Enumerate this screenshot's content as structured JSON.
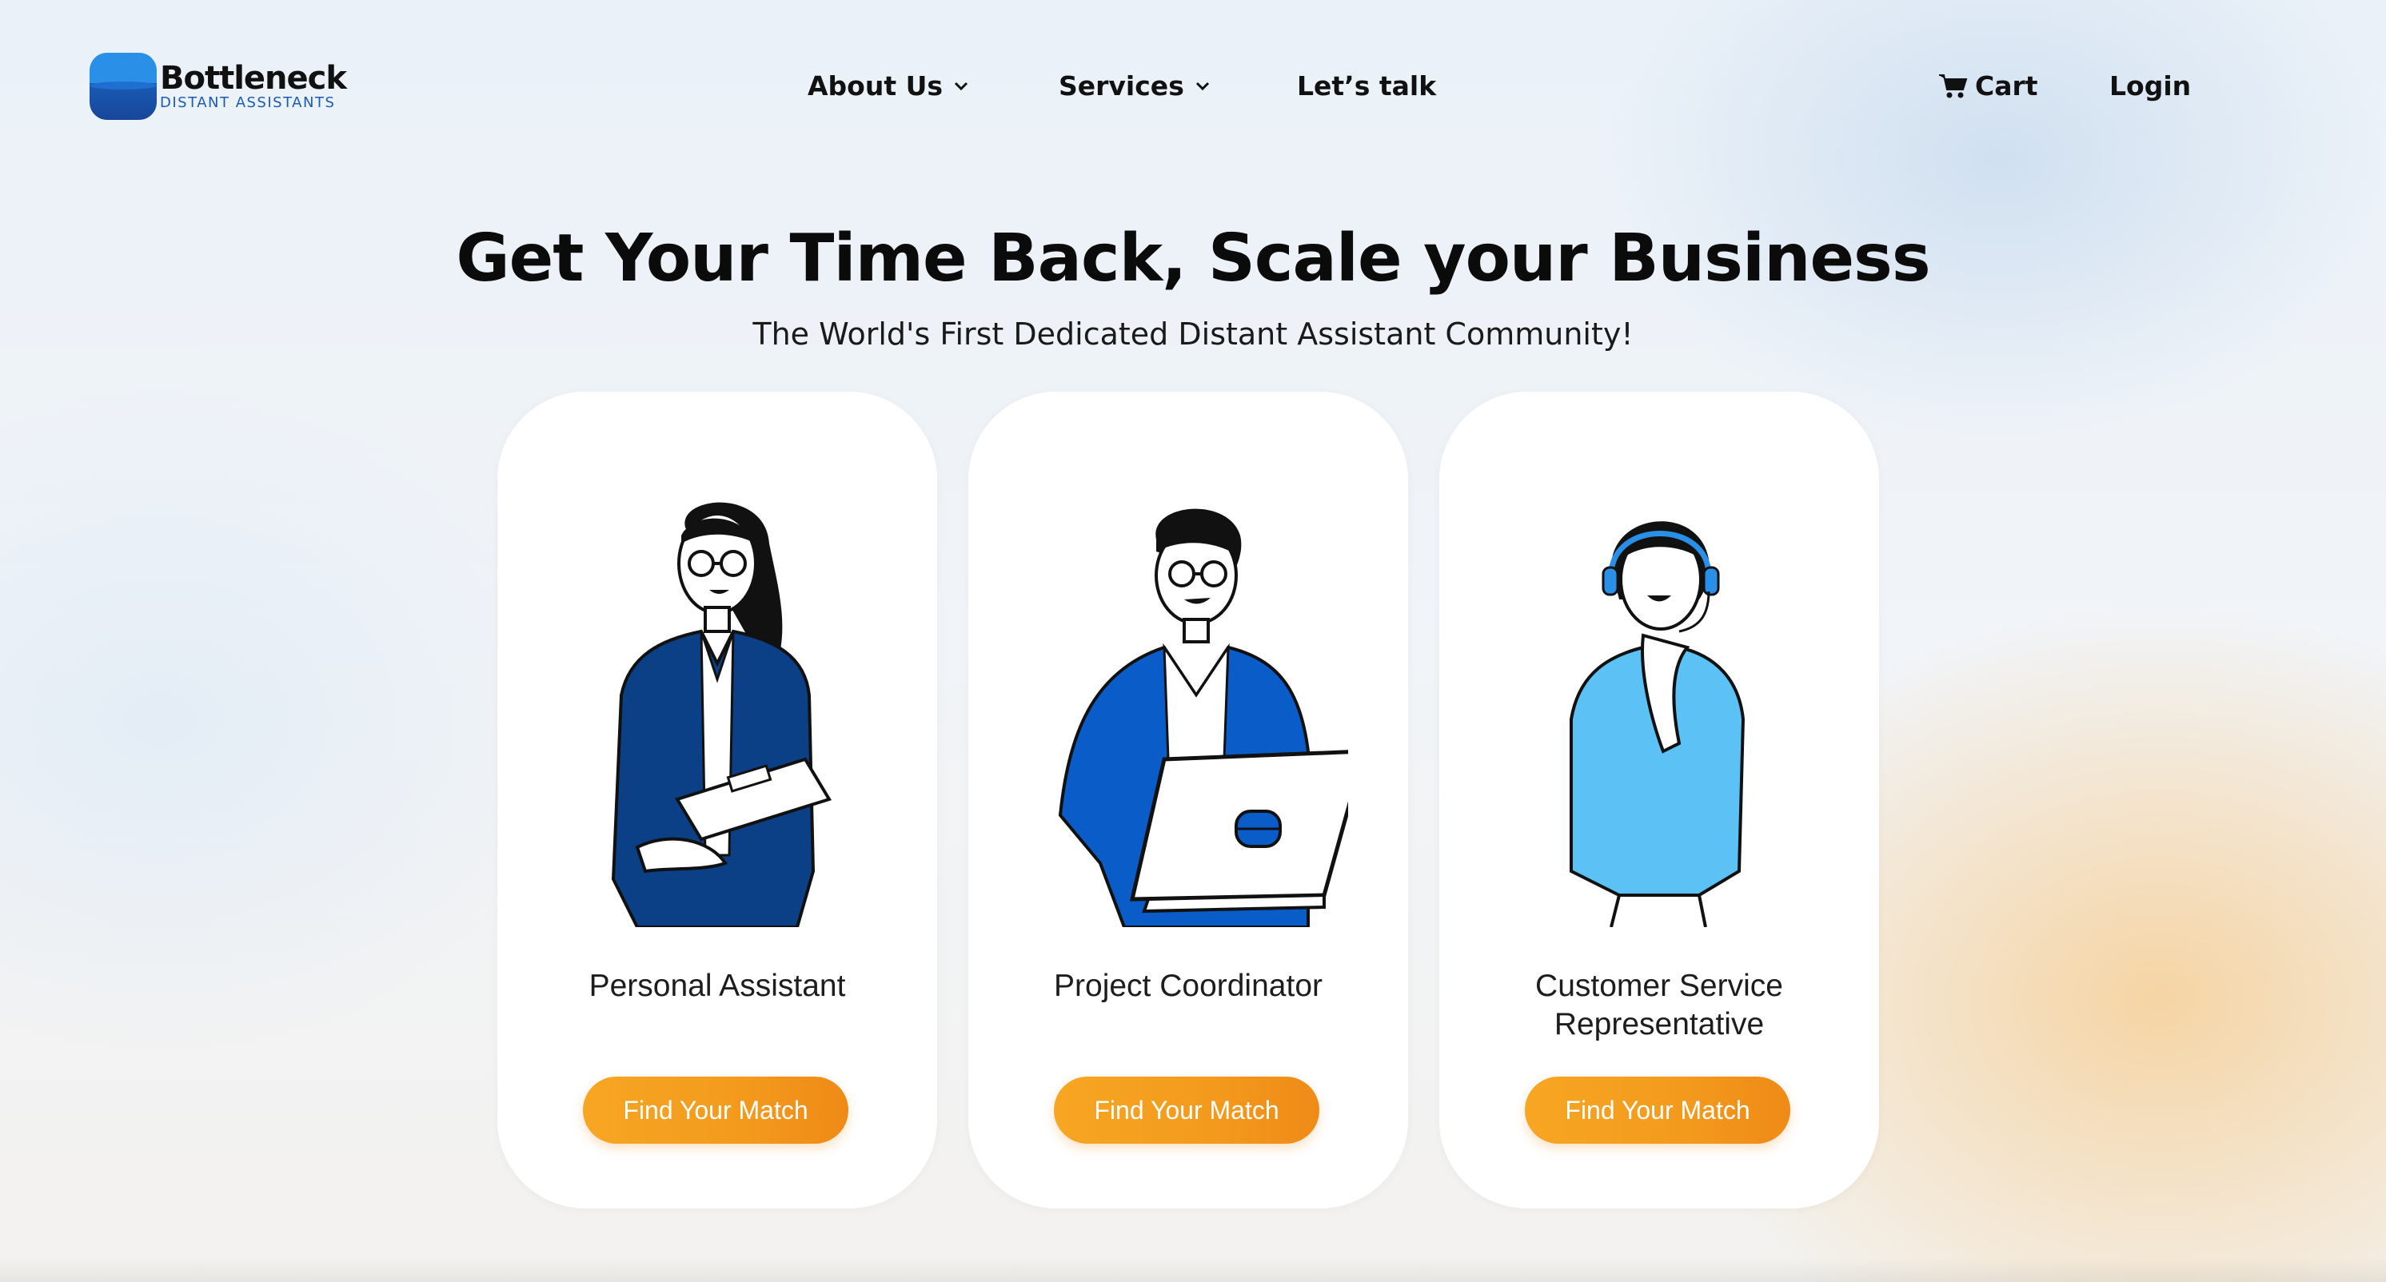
{
  "brand": {
    "name": "Bottleneck",
    "tagline": "DISTANT ASSISTANTS"
  },
  "nav": {
    "about": "About Us",
    "services": "Services",
    "talk": "Let’s talk",
    "cart": "Cart",
    "login": "Login"
  },
  "hero": {
    "title": "Get Your Time Back, Scale your Business",
    "subtitle": "The World's First Dedicated Distant Assistant Community!"
  },
  "cards": [
    {
      "title": "Personal Assistant",
      "button": "Find Your Match",
      "illustration": "woman-with-clipboard",
      "accent": "#0b3f86"
    },
    {
      "title": "Project Coordinator",
      "button": "Find Your Match",
      "illustration": "man-with-laptop",
      "accent": "#0a5cc9"
    },
    {
      "title": "Customer Service Representative",
      "button": "Find Your Match",
      "illustration": "woman-with-headset",
      "accent": "#5cc2f5"
    }
  ],
  "colors": {
    "button": "#f39a1d",
    "logo_blue": "#2a8fe6"
  }
}
